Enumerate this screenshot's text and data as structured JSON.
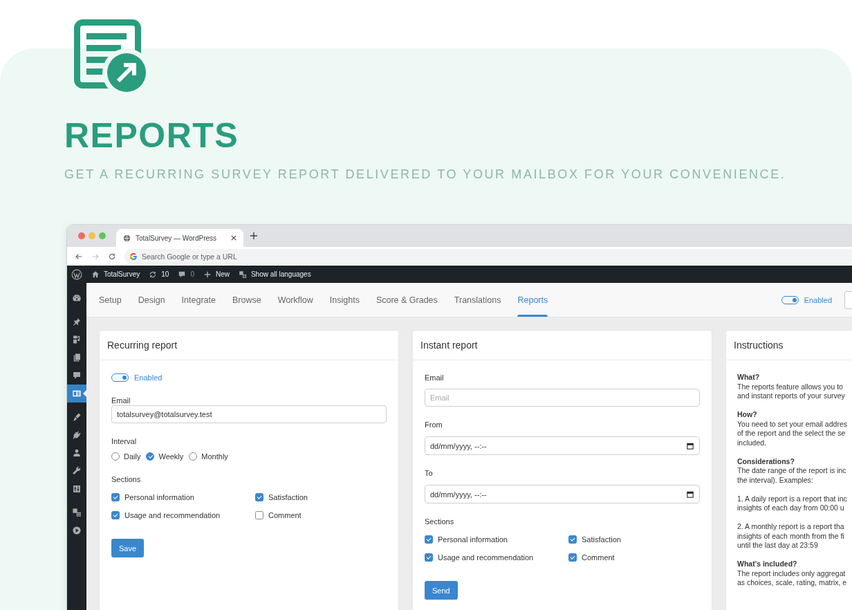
{
  "hero": {
    "title": "REPORTS",
    "subtitle": "GET A RECURRING SURVEY REPORT DELIVERED TO YOUR MAILBOX FOR YOUR CONVENIENCE."
  },
  "browser": {
    "window_buttons": [
      {
        "color": "#ee6a5f"
      },
      {
        "color": "#f5be4f"
      },
      {
        "color": "#62c554"
      }
    ],
    "tab": {
      "title": "TotalSurvey — WordPress"
    },
    "nav_buttons": [
      {
        "kind": "back",
        "disabled": false
      },
      {
        "kind": "forward",
        "disabled": true
      },
      {
        "kind": "reload",
        "disabled": false
      }
    ],
    "address_bar": {
      "placeholder": "Search Google or type a URL"
    }
  },
  "admin_bar": {
    "items": [
      {
        "kind": "site",
        "label": "TotalSurvey"
      },
      {
        "kind": "updates",
        "label": "10"
      },
      {
        "kind": "comments",
        "label": "0"
      },
      {
        "kind": "new",
        "label": "New"
      },
      {
        "kind": "languages",
        "label": "Show all languages"
      }
    ]
  },
  "sidebar": {
    "groups": [
      {
        "items": [
          {
            "kind": "dashboard",
            "selected": false
          }
        ]
      },
      {
        "items": [
          {
            "kind": "posts",
            "selected": false
          },
          {
            "kind": "media",
            "selected": false
          },
          {
            "kind": "pages",
            "selected": false
          },
          {
            "kind": "comments",
            "selected": false
          },
          {
            "kind": "surveys",
            "selected": true
          }
        ]
      },
      {
        "items": [
          {
            "kind": "appearance",
            "selected": false
          },
          {
            "kind": "plugins",
            "selected": false
          },
          {
            "kind": "users",
            "selected": false
          },
          {
            "kind": "tools",
            "selected": false
          },
          {
            "kind": "settings",
            "selected": false
          }
        ]
      },
      {
        "items": [
          {
            "kind": "translations",
            "selected": false
          },
          {
            "kind": "media_player",
            "selected": false
          }
        ]
      }
    ]
  },
  "nav": {
    "tabs": [
      {
        "label": "Setup",
        "selected": false
      },
      {
        "label": "Design",
        "selected": false
      },
      {
        "label": "Integrate",
        "selected": false
      },
      {
        "label": "Browse",
        "selected": false
      },
      {
        "label": "Workflow",
        "selected": false
      },
      {
        "label": "Insights",
        "selected": false
      },
      {
        "label": "Score & Grades",
        "selected": false
      },
      {
        "label": "Translations",
        "selected": false
      },
      {
        "label": "Reports",
        "selected": true
      }
    ],
    "toggle": {
      "label": "Enabled",
      "on": true
    }
  },
  "cards": [
    {
      "kind": "form",
      "title": "Recurring report",
      "fields": [
        {
          "kind": "toggle",
          "label": "Enabled",
          "on": true
        },
        {
          "kind": "email",
          "label": "Email",
          "value": "totalsurvey@totalsurvey.test"
        },
        {
          "kind": "radios",
          "label": "Interval",
          "options": [
            {
              "label": "Daily",
              "selected": false
            },
            {
              "label": "Weekly",
              "selected": true
            },
            {
              "label": "Monthly",
              "selected": false
            }
          ]
        },
        {
          "kind": "checkboxes",
          "label": "Sections",
          "options": [
            {
              "label": "Personal information",
              "checked": true
            },
            {
              "label": "Satisfaction",
              "checked": true
            },
            {
              "label": "Usage and recommendation",
              "checked": true
            },
            {
              "label": "Comment",
              "checked": false
            }
          ]
        },
        {
          "kind": "button",
          "label": "Save"
        }
      ]
    },
    {
      "kind": "form",
      "title": "Instant report",
      "fields": [
        {
          "kind": "email",
          "label": "Email",
          "placeholder": "Email"
        },
        {
          "kind": "datetime",
          "label": "From",
          "value": "dd/mm/yyyy, --:--"
        },
        {
          "kind": "datetime",
          "label": "To",
          "value": "dd/mm/yyyy, --:--"
        },
        {
          "kind": "checkboxes",
          "label": "Sections",
          "options": [
            {
              "label": "Personal information",
              "checked": true
            },
            {
              "label": "Satisfaction",
              "checked": true
            },
            {
              "label": "Usage and recommendation",
              "checked": true
            },
            {
              "label": "Comment",
              "checked": true
            }
          ]
        },
        {
          "kind": "button",
          "label": "Send"
        }
      ]
    },
    {
      "kind": "notes",
      "title": "Instructions",
      "sections": [
        {
          "heading": "What?",
          "paragraphs": [
            {
              "lines": [
                "The reports feature allows you to",
                "and instant reports of your survey"
              ]
            }
          ]
        },
        {
          "heading": "How?",
          "paragraphs": [
            {
              "lines": [
                "You need to set your email addres",
                "of the report and the select the se",
                "included."
              ]
            }
          ]
        },
        {
          "heading": "Considerations?",
          "paragraphs": [
            {
              "lines": [
                "The date range of the report is inc",
                "the interval). Examples:"
              ]
            },
            {
              "lines": [
                "1. A daily report is a report that inc",
                "insights of each day from 00:00 u"
              ]
            },
            {
              "lines": [
                "2. A monthly report is a report tha",
                "insights of each month from the fi",
                "until the last day at 23:59"
              ]
            }
          ]
        },
        {
          "heading": "What's included?",
          "paragraphs": [
            {
              "lines": [
                "The report includes only aggregat",
                "as choices, scale, rating, matrix, e"
              ]
            }
          ]
        }
      ]
    }
  ]
}
